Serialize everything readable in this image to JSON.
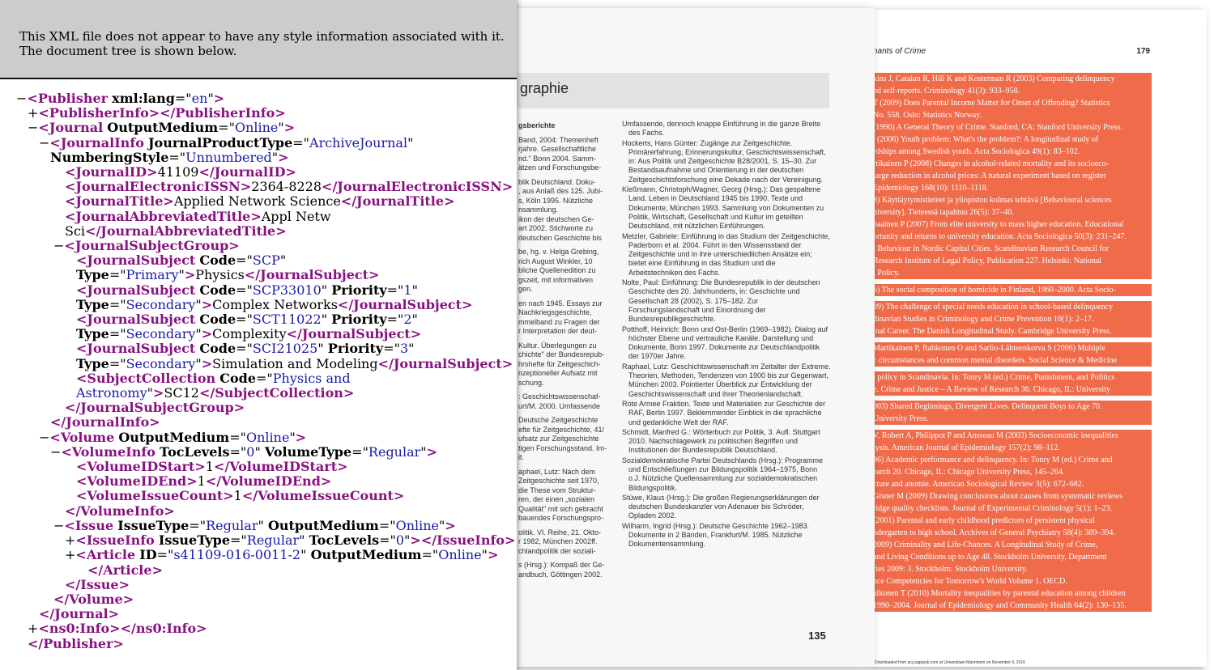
{
  "xml_notice": {
    "line1": "This XML file does not appear to have any style information associated with it.",
    "line2": "The document tree is shown below."
  },
  "xml": {
    "publisher_attr_val": "en",
    "journal_output_medium": "Online",
    "journal_product_type": "ArchiveJournal",
    "numbering_style": "Unnumbered",
    "journal_id": "41109",
    "electronic_issn": "2364-8228",
    "journal_title": "Applied Network Science",
    "abbrev_title_1": "Appl Netw",
    "abbrev_title_2": "Sci",
    "subjects": [
      {
        "code": "SCP",
        "type": "Primary",
        "text": "Physics"
      },
      {
        "code": "SCP33010",
        "priority": "1",
        "type": "Secondary",
        "text": "Complex Networks"
      },
      {
        "code": "SCT11022",
        "priority": "2",
        "type": "Secondary",
        "text": "Complexity"
      },
      {
        "code": "SCI21025",
        "priority": "3",
        "type": "Secondary",
        "text": "Simulation and Modeling"
      }
    ],
    "collection_code_1": "Physics and",
    "collection_code_2": "Astronomy",
    "collection_value": "SC12",
    "volume_output_medium": "Online",
    "toc_levels": "0",
    "volume_type": "Regular",
    "volume_id_start": "1",
    "volume_id_end": "1",
    "volume_issue_count": "1",
    "issue_type": "Regular",
    "issue_output_medium": "Online",
    "issue_info_type": "Regular",
    "issue_toc_levels": "0",
    "article_id": "s41109-016-0011-2",
    "article_output_medium": "Online"
  },
  "right_page": {
    "header": "nants of Crime",
    "page_number": "179",
    "lines": [
      "kins J, Catalan R, Hill K and Kosterman R (2003) Comparing delinquency",
      "nd self-reports. Criminology 41(3): 933–958.",
      "T (2009) Does Parental Income Matter for Onset of Offending? Statistics",
      "No. 558. Oslo: Statistics Norway.",
      "(1990) A General Theory of Crime. Stanford, CA: Stanford University Press.",
      ". (2006) Youth problem: What's the problem?: A longitudinal study of",
      "rdships among Swedish youth. Acta Sociologica 49(1): 83–102.",
      "rtikainen P (2008) Changes in alcohol-related mortality and its socioeco-",
      "large reduction in alcohol prices: A natural experiment based on register",
      "Epidemiology 168(10): 1110–1118.",
      "8) Käyttäytymistieteet ja yliopiston kolmas tehtävä [Behavioural sciences",
      "niversity]. Tieteessä tapahtuu 26(5): 37–40.",
      "paainen P (2007) From elite university to mass higher education. Educational",
      "ortunity and returns to university education. Acta Sociologica 50(3): 231–247.",
      "t Behaviour in Nordic Capital Cities. Scandinavian Research Council for",
      "Research Institute of Legal Policy, Publication 227. Helsinki: National",
      "l Policy.",
      "6) The social composition of homicide in Finland, 1960–2000. Acta Socio-",
      "09) The challenge of special needs education in school-based delinquency",
      "dinavian Studies in Criminology and Crime Prevention 10(1): 2–17.",
      "inal Career. The Danish Longitudinal Study. Cambridge University Press.",
      "Martikainen P, Rahkonen O and Sarlio-Lähteenkorva S (2006) Multiple",
      "c circumstances and common mental disorders. Social Science & Medicine",
      "l policy in Scandinavia. In: Tonry M (ed.) Crime, Punishment, and Politics",
      "e. Crime and Justice – A Review of Research 36. Chicago, IL: University",
      "003) Shared Beginnings, Divergent Lives. Delinquent Boys to Age 70.",
      "University Press.",
      "V, Robert A, Philippot P and Ansseau M (2003) Socioeconomic inequalities",
      "lysis. American Journal of Epidemiology 157(2): 98–112.",
      "96) Academic performance and delinquency. In: Tonry M (ed.) Crime and",
      "earch 20. Chicago, IL: Chicago University Press, 145–264.",
      "cture and anomie. American Sociological Review 3(5): 672–682.",
      "Gisner M (2009) Drawing conclusions about causes from systematic reviews",
      "ridge quality checklists. Journal of Experimental Criminology 5(1): 1–23.",
      "(2001) Parental and early childhood predictors of persistent physical",
      "ndergarten to high school. Archives of General Psychiatry 58(4): 389–394.",
      "2009) Criminality and Life-Chances. A Longitudinal Study of Crime,",
      "and Living Conditions up to Age 48. Stockholm University, Department",
      "ries 2009: 3. Stockholm: Stockholm University.",
      "nce Competencies for Tomorrow's World Volume 1. OECD.",
      "alkonen T (2010) Mortality inequalities by parental education among children",
      "1990–2004. Journal of Epidemiology and Community Health 64(2): 130–135."
    ],
    "footer": "Downloaded from acj.sagepub.com at Universitaet Mannheim on November 9, 2016"
  },
  "mid_page": {
    "title": "graphie",
    "page_number": "135",
    "left_col": [
      "gsberichte",
      "Band, 2004: Themenheft",
      "rjahre. Gesellschaftliche",
      "nd.\" Bonn 2004. Samm-",
      "ätzen und Forschungsbe-",
      "blik Deutschland. Doku-",
      ", aus Anlaß des 125. Jubi-",
      "s, Köln 1995. Nützliche",
      "nsammlung.",
      "ikon der deutschen Ge-",
      "art 2002. Stichworte zu",
      "deutschen Geschichte bis",
      "be, hg. v. Helga Grebing,",
      "rich August Winkler, 10",
      "bliche Quellenedition zu",
      "gszeit, mit informativen",
      "gen.",
      "en nach 1945. Essays zur",
      "Nachkriegsgeschichte,",
      "mmelband zu Fragen der",
      "r Interpretation der deut-",
      "Kultur. Überlegungen zu",
      "chichte\" der Bundesrepub-",
      "hrshefte für Zeitgeschich-",
      "nzeptioneller Aufsatz mit",
      "schung.",
      ": Geschichtswissenschaf-",
      "urt/M. 2000. Umfassende",
      "Deutsche Zeitgeschichte",
      "efte für Zeitgeschichte, 41/",
      "ufsatz zur Zeitgeschichte",
      "tigen Forschungsstand. Im-",
      "it.",
      "aphael, Lutz: Nach dem",
      "Zeitgeschichte seit 1970,",
      "die These vom Struktur-",
      "ren, der einen „sozialen",
      "Qualität\" mit sich gebracht",
      "bauendes Forschungspro-",
      "olitik. VI. Reihe, 21. Okto-",
      "r 1982, München 2002ff.",
      "chlandpolitik der soziali-",
      "s (Hrsg.): Kompaß der Ge-",
      "andbuch, Göttingen 2002."
    ],
    "right_col": [
      "Umfassende, dennoch knappe Einführung in die ganze Breite des Fachs.",
      "Hockerts, Hans Günter: Zugänge zur Zeitgeschichte. Primärerfahrung, Erinnerungskultur, Geschichtswissenschaft, in: Aus Politik und Zeitgeschichte B28/2001, S. 15–30. Zur Bestandsaufnahme und Orientierung in der deutschen Zeitgeschichtsforschung eine Dekade nach der Vereinigung.",
      "Kleßmann, Christoph/Wagner, Georg (Hrsg.): Das gespaltene Land. Leben in Deutschland 1945 bis 1990. Texte und Dokumente, München 1993. Sammlung von Dokumenten zu Politik, Wirtschaft, Gesellschaft und Kultur im geteilten Deutschland, mit nützlichen Einführungen.",
      "Metzler, Gabriele: Einführung in das Studium der Zeitgeschichte, Paderborn et al. 2004. Führt in den Wissensstand der Zeitgeschichte und in ihre unterschiedlichen Ansätze ein; bietet eine Einführung in das Studium und die Arbeitstechniken des Fachs.",
      "Nolte, Paul: Einführung: Die Bundesrepublik in der deutschen Geschichte des 20. Jahrhunderts, in: Geschichte und Gesellschaft 28 (2002), S. 175–182. Zur Forschungslandschaft und Einordnung der Bundesrepublikgeschichte.",
      "Potthoff, Heinrich: Bonn und Ost-Berlin (1969–1982). Dialog auf höchster Ebene und vertrauliche Kanäle. Darstellung und Dokumente, Bonn 1997. Dokumente zur Deutschlandpolitik der 1970er Jahre.",
      "Raphael, Lutz: Geschichtswissenschaft im Zeitalter der Extreme. Theorien, Methoden, Tendenzen von 1900 bis zur Gegenwart, München 2003. Pointierter Überblick zur Entwicklung der Geschichtswissenschaft und ihrer Theorienlandschaft.",
      "Rote Armee Fraktion. Texte und Materialien zur Geschichte der RAF, Berlin 1997. Beklemmender Einblick in die sprachliche und gedankliche Welt der RAF.",
      "Schmidt, Manfred G.: Wörterbuch zur Politik, 3. Aufl. Stuttgart 2010. Nachschlagewerk zu politischen Begriffen und Institutionen der Bundesrepublik Deutschland.",
      "Sozialdemokratische Partei Deutschlands (Hrsg.): Programme und Entschließungen zur Bildungspolitik 1964–1975, Bonn o.J. Nützliche Quellensammlung zur sozialdemokratischen Bildungspolitik.",
      "Stüwe, Klaus (Hrsg.): Die großen Regierungserklärungen der deutschen Bundeskanzler von Adenauer bis Schröder, Opladen 2002.",
      "Wilharm, Ingrid (Hrsg.): Deutsche Geschichte 1962–1983. Dokumente in 2 Bänden, Frankfurt/M. 1985. Nützliche Dokumentensammlung."
    ]
  }
}
